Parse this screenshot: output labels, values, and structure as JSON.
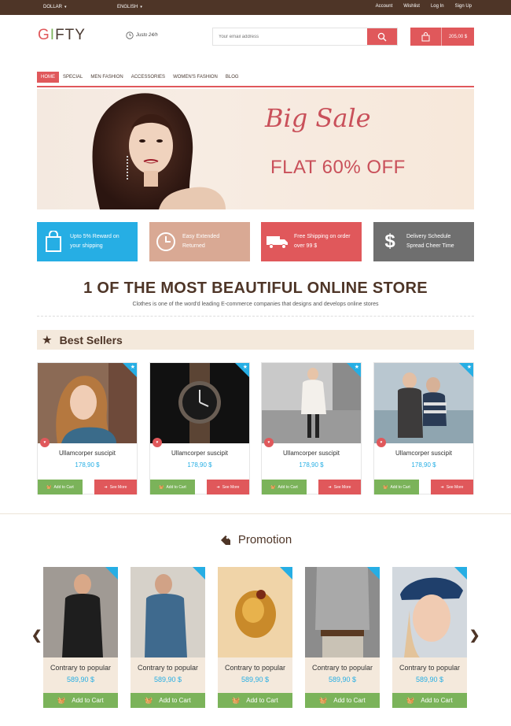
{
  "topbar": {
    "currency": "DOLLAR",
    "language": "ENGLISH",
    "links": [
      "Account",
      "Wishlist",
      "Log In",
      "Sign Up"
    ]
  },
  "header": {
    "logo": {
      "g": "G",
      "i": "I",
      "rest": "FTY"
    },
    "hours": "Justo 24/h",
    "search_placeholder": "Your email address",
    "cart_amount": "205,00 $"
  },
  "nav": [
    "HOME",
    "SPECIAL",
    "MEN FASHION",
    "ACCESSORIES",
    "WOMEN'S FASHION",
    "BLOG"
  ],
  "banner": {
    "headline": "Big Sale",
    "subline": "FLAT 60% OFF"
  },
  "features": [
    {
      "line1": "Upto 5% Reward on",
      "line2": "your shipping",
      "icon": "shopping-bag-icon"
    },
    {
      "line1": "Easy Extended",
      "line2": "Returned",
      "icon": "clock-icon"
    },
    {
      "line1": "Free Shipping on order",
      "line2": "over 99 $",
      "icon": "truck-icon"
    },
    {
      "line1": "Delivery Schedule",
      "line2": "Spread Cheer Time",
      "icon": "dollar-icon"
    }
  ],
  "store": {
    "title": "1 OF THE MOST BEAUTIFUL ONLINE STORE",
    "subtitle": "Clothes is one of the word'd leading E-commerce companies that designs and develops online stores"
  },
  "best_sellers": {
    "title": "Best Sellers",
    "products": [
      {
        "name": "Ullamcorper suscipit",
        "price": "178,90 $"
      },
      {
        "name": "Ullamcorper suscipit",
        "price": "178,90 $"
      },
      {
        "name": "Ullamcorper suscipit",
        "price": "178,90 $"
      },
      {
        "name": "Ullamcorper suscipit",
        "price": "178,90 $"
      }
    ],
    "add_label": "Add to Cart",
    "more_label": "See More"
  },
  "promotion": {
    "title": "Promotion",
    "products": [
      {
        "name": "Contrary to popular",
        "price": "589,90 $"
      },
      {
        "name": "Contrary to popular",
        "price": "589,90 $"
      },
      {
        "name": "Contrary to popular",
        "price": "589,90 $"
      },
      {
        "name": "Contrary to popular",
        "price": "589,90 $"
      },
      {
        "name": "Contrary to popular",
        "price": "589,90 $"
      }
    ],
    "add_label": "Add to Cart"
  },
  "colors": {
    "accent": "#e0585b",
    "blue": "#26aee4",
    "green": "#7bb35a",
    "brown": "#4e3527",
    "beige": "#f4e9dc"
  }
}
